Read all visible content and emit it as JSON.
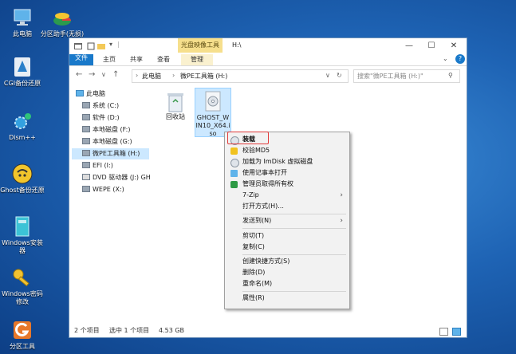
{
  "desktop": {
    "icons": [
      {
        "label": "此电脑",
        "icon": "computer-icon"
      },
      {
        "label": "分区助手(无损)",
        "icon": "partition-icon"
      },
      {
        "label": "CGI备份还原",
        "icon": "cgi-icon"
      },
      {
        "label": "Dism++",
        "icon": "gears-icon"
      },
      {
        "label": "Ghost备份还原",
        "icon": "ghost-icon"
      },
      {
        "label": "Windows安装器",
        "icon": "installer-icon"
      },
      {
        "label": "Windows密码修改",
        "icon": "key-icon"
      },
      {
        "label": "分区工具",
        "icon": "partition-tool-icon"
      }
    ]
  },
  "window": {
    "context_tab": "光盘映像工具",
    "title": "H:\\",
    "controls": {
      "minimize": "—",
      "maximize": "☐",
      "close": "✕"
    },
    "ribbon_tabs": [
      "文件",
      "主页",
      "共享",
      "查看",
      "管理"
    ],
    "help": "?",
    "breadcrumb": [
      "此电脑",
      "微PE工具箱 (H:)"
    ],
    "search_placeholder": "搜索\"微PE工具箱 (H:)\"",
    "nav": [
      {
        "label": "此电脑",
        "icon": "computer-icon"
      },
      {
        "label": "系统 (C:)",
        "icon": "drive-icon"
      },
      {
        "label": "软件 (D:)",
        "icon": "drive-icon"
      },
      {
        "label": "本地磁盘 (F:)",
        "icon": "drive-icon"
      },
      {
        "label": "本地磁盘 (G:)",
        "icon": "drive-icon"
      },
      {
        "label": "微PE工具箱 (H:)",
        "icon": "drive-icon"
      },
      {
        "label": "EFI (I:)",
        "icon": "drive-icon"
      },
      {
        "label": "DVD 驱动器 (J:) GH",
        "icon": "dvd-icon"
      },
      {
        "label": "WEPE (X:)",
        "icon": "drive-icon"
      }
    ],
    "files": [
      {
        "name": "回收站",
        "icon": "recycle-bin-icon"
      },
      {
        "name": "GHOST_WIN10_X64.iso",
        "line1": "GHOST_W",
        "line2": "IN10_X64.i",
        "line3": "so",
        "icon": "iso-disc-icon"
      }
    ],
    "status": {
      "count": "2 个项目",
      "selected": "选中 1 个项目",
      "size": "4.53 GB"
    }
  },
  "context_menu": {
    "items": [
      {
        "label": "装载",
        "icon": "disc-icon",
        "bold": true
      },
      {
        "label": "校验MD5",
        "icon": "shield-icon"
      },
      {
        "label": "加载为 ImDisk 虚拟磁盘",
        "icon": "disc-icon"
      },
      {
        "label": "使用记事本打开",
        "icon": "notepad-icon"
      },
      {
        "label": "管理员取得所有权",
        "icon": "admin-shield-icon"
      },
      {
        "label": "7-Zip",
        "submenu": true
      },
      {
        "label": "打开方式(H)..."
      },
      {
        "label": "发送到(N)",
        "submenu": true
      },
      {
        "label": "剪切(T)"
      },
      {
        "label": "复制(C)"
      },
      {
        "label": "创建快捷方式(S)"
      },
      {
        "label": "删除(D)"
      },
      {
        "label": "重命名(M)"
      },
      {
        "label": "属性(R)"
      }
    ]
  }
}
